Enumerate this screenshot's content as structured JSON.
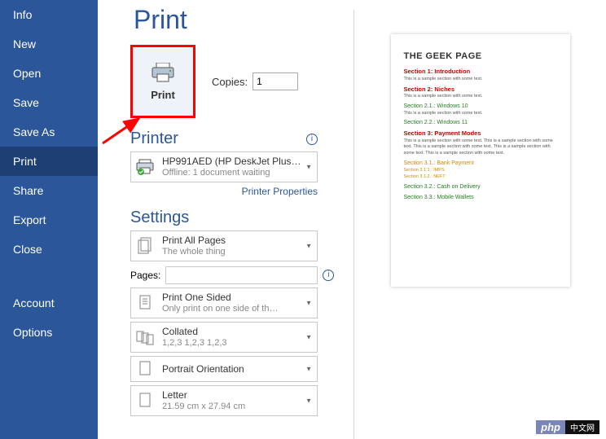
{
  "sidebar": {
    "items": [
      "Info",
      "New",
      "Open",
      "Save",
      "Save As",
      "Print",
      "Share",
      "Export",
      "Close"
    ],
    "footer_items": [
      "Account",
      "Options"
    ],
    "selected_index": 5
  },
  "title": "Print",
  "print_button_label": "Print",
  "copies_label": "Copies:",
  "copies_value": "1",
  "printer_section_label": "Printer",
  "printer": {
    "name": "HP991AED (HP DeskJet Plus…",
    "status": "Offline: 1 document waiting"
  },
  "printer_properties_link": "Printer Properties",
  "settings_section_label": "Settings",
  "settings": {
    "print_what": {
      "line1": "Print All Pages",
      "line2": "The whole thing"
    },
    "pages_label": "Pages:",
    "pages_value": "",
    "sides": {
      "line1": "Print One Sided",
      "line2": "Only print on one side of th…"
    },
    "collate": {
      "line1": "Collated",
      "line2": "1,2,3    1,2,3    1,2,3"
    },
    "orientation": {
      "line1": "Portrait Orientation"
    },
    "paper": {
      "line1": "Letter",
      "line2": "21.59 cm x 27.94 cm"
    }
  },
  "preview": {
    "heading": "THE GEEK PAGE",
    "sect1": "Section 1: Introduction",
    "body1": "This is a sample section with some text.",
    "sect2": "Section 2: Niches",
    "body2": "This is a sample section with some text.",
    "sect21": "Section 2.1.: Windows 10",
    "body21": "This is a sample section with some text.",
    "sect22": "Section 2.2.: Windows 11",
    "sect3": "Section 3: Payment Modes",
    "body3": "This is a sample section with some text. This is a sample section with some text. This is a sample section with some text. This is a sample section with some text. This is a sample section with some text.",
    "sect31": "Section 3.1.: Bank Payment",
    "sect311": "Section 3.1.1.: IMPS",
    "sect312": "Section 3.1.2.: NEFT",
    "sect32": "Section 3.2.: Cash on Delivery",
    "sect33": "Section 3.3.: Mobile Wallets"
  },
  "watermark": {
    "php": "php",
    "cn": "中文网"
  }
}
